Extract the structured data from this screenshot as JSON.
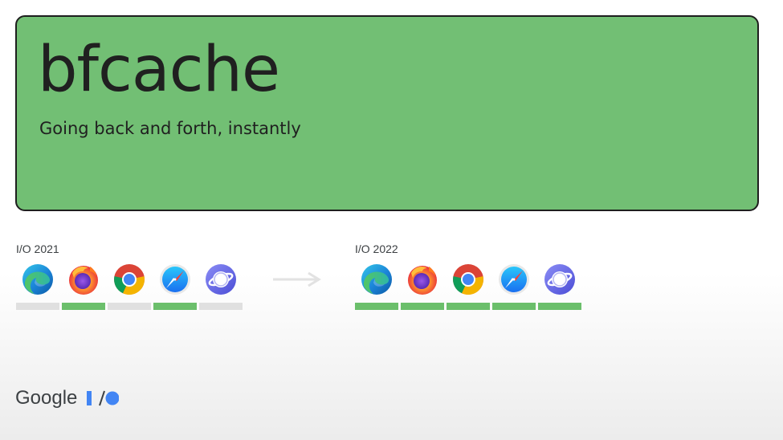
{
  "slide": {
    "title": "bfcache",
    "subtitle": "Going back and forth, instantly"
  },
  "colors": {
    "hero_background": "#72bf74",
    "supported": "#6bbf6b",
    "unsupported": "#e0e0e0",
    "text": "#202020",
    "io_blue": "#4285f4"
  },
  "before": {
    "label": "I/O 2021",
    "browsers": [
      {
        "name": "Edge",
        "icon": "edge-icon",
        "supported": false
      },
      {
        "name": "Firefox",
        "icon": "firefox-icon",
        "supported": true
      },
      {
        "name": "Chrome",
        "icon": "chrome-icon",
        "supported": false
      },
      {
        "name": "Safari",
        "icon": "safari-icon",
        "supported": true
      },
      {
        "name": "Samsung Internet",
        "icon": "samsung-internet-icon",
        "supported": false
      }
    ]
  },
  "after": {
    "label": "I/O 2022",
    "browsers": [
      {
        "name": "Edge",
        "icon": "edge-icon",
        "supported": true
      },
      {
        "name": "Firefox",
        "icon": "firefox-icon",
        "supported": true
      },
      {
        "name": "Chrome",
        "icon": "chrome-icon",
        "supported": true
      },
      {
        "name": "Safari",
        "icon": "safari-icon",
        "supported": true
      },
      {
        "name": "Samsung Internet",
        "icon": "samsung-internet-icon",
        "supported": true
      }
    ]
  },
  "footer": {
    "brand": "Google",
    "logo": "io-logo"
  }
}
